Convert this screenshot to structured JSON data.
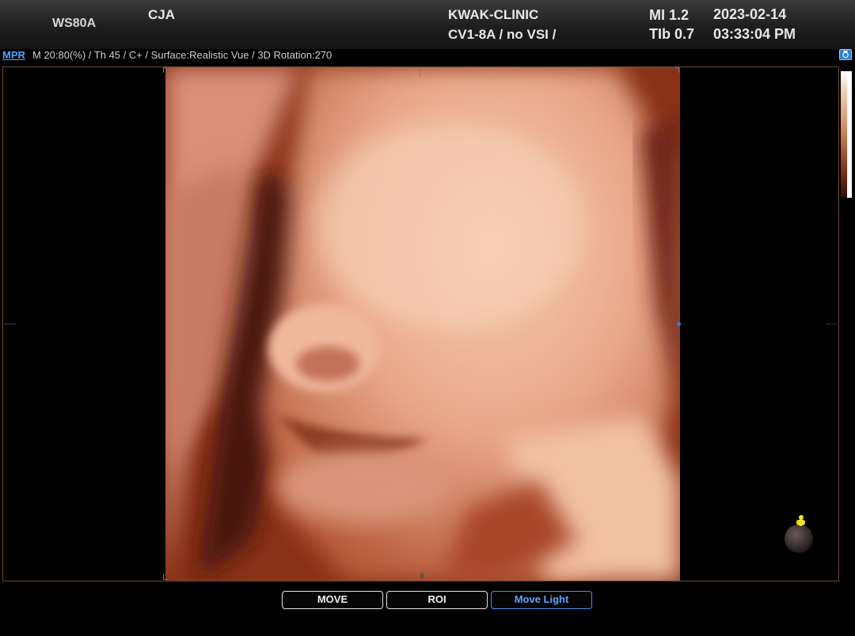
{
  "header": {
    "device": "WS80A",
    "patient_id": "CJA",
    "institution": "KWAK-CLINIC",
    "probe_preset": "CV1-8A / no VSI /",
    "mi": "MI  1.2",
    "tib": "TIb 0.7",
    "date": "2023-02-14",
    "time": "03:33:04 PM"
  },
  "infobar": {
    "mode_link": "MPR",
    "params": "M 20:80(%) / Th 45 / C+ / Surface:Realistic Vue / 3D Rotation:270"
  },
  "buttons": {
    "move": "MOVE",
    "roi": "ROI",
    "move_light": "Move Light"
  },
  "colors": {
    "accent_blue": "#4f8fe8",
    "skin_tone": "#e7a589",
    "frame_border": "#6b4a30"
  }
}
